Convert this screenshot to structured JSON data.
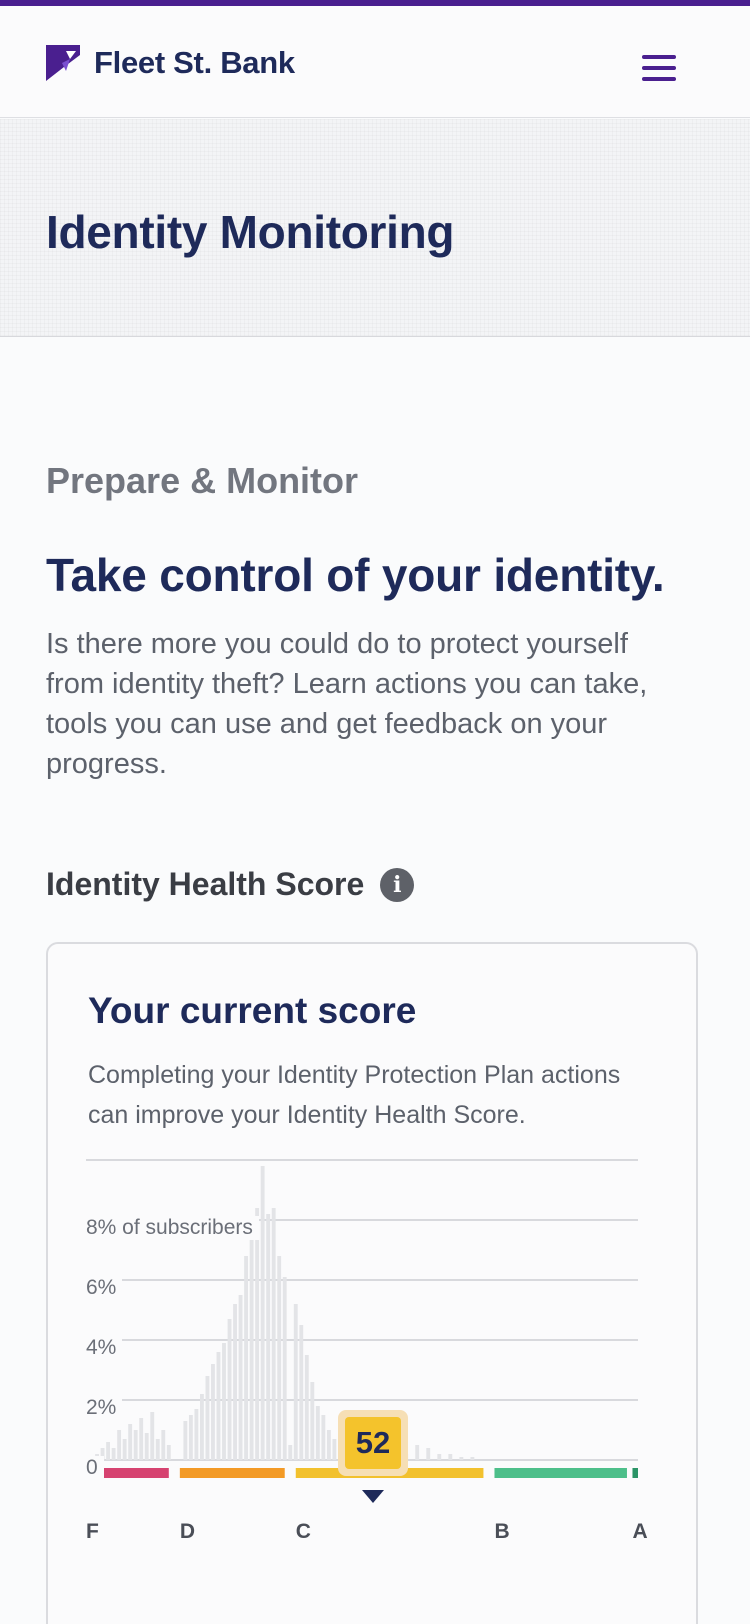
{
  "header": {
    "brand": "Fleet St. Bank",
    "logo_icon": "flag-logo-icon",
    "menu_icon": "hamburger-menu-icon",
    "accent_color": "#4a1f8f"
  },
  "hero": {
    "title": "Identity Monitoring"
  },
  "section": {
    "eyebrow": "Prepare & Monitor",
    "headline": "Take control of your identity.",
    "intro": "Is there more you could do to protect yourself from identity theft? Learn actions you can take, tools you can use and get feedback on your progress."
  },
  "score_section": {
    "title": "Identity Health Score",
    "info_icon": "info-icon",
    "card": {
      "title": "Your current score",
      "description": "Completing your Identity Protection Plan actions can improve your Identity Health Score.",
      "current_score": "52"
    }
  },
  "chart_data": {
    "type": "bar",
    "y_tick_labels": [
      "8% of subscribers",
      "6%",
      "4%",
      "2%",
      "0"
    ],
    "y_ticks": [
      8,
      6,
      4,
      2,
      0
    ],
    "ylim": [
      0,
      10
    ],
    "xlim": [
      0,
      100
    ],
    "grid": true,
    "grades": [
      {
        "label": "F",
        "range": [
          0,
          15
        ],
        "color": "#d64270"
      },
      {
        "label": "D",
        "range": [
          17,
          36
        ],
        "color": "#f39a26"
      },
      {
        "label": "C",
        "range": [
          38,
          72
        ],
        "color": "#f2c12e"
      },
      {
        "label": "B",
        "range": [
          74,
          98
        ],
        "color": "#4dbf8a"
      },
      {
        "label": "A",
        "range": [
          99,
          100
        ],
        "color": "#2b9467"
      }
    ],
    "grade_labels": [
      "F",
      "D",
      "C",
      "B",
      "A"
    ],
    "x": [
      2,
      3,
      4,
      5,
      6,
      7,
      8,
      9,
      10,
      11,
      12,
      13,
      14,
      15,
      18,
      19,
      20,
      21,
      22,
      23,
      24,
      25,
      26,
      27,
      28,
      29,
      30,
      31,
      32,
      33,
      34,
      35,
      36,
      37,
      38,
      39,
      40,
      41,
      42,
      43,
      44,
      45,
      46,
      47,
      48,
      49,
      50,
      52,
      54,
      56,
      58,
      60,
      62,
      64,
      66,
      68,
      70
    ],
    "values": [
      0.2,
      0.4,
      0.6,
      0.4,
      1.0,
      0.7,
      1.2,
      1.0,
      1.4,
      0.9,
      1.6,
      0.7,
      1.0,
      0.5,
      1.3,
      1.5,
      1.7,
      2.2,
      2.8,
      3.2,
      3.6,
      3.9,
      4.7,
      5.2,
      5.5,
      6.8,
      7.5,
      8.4,
      9.8,
      8.2,
      8.4,
      6.8,
      6.1,
      0.5,
      5.2,
      4.5,
      3.5,
      2.6,
      1.8,
      1.5,
      1.0,
      0.7,
      0.6,
      0.5,
      0.4,
      0.3,
      0.3,
      0.2,
      0.2,
      0.1,
      0.2,
      0.5,
      0.4,
      0.2,
      0.2,
      0.1,
      0.1
    ],
    "bar_color": "#e3e4e7",
    "marker": {
      "label": "52",
      "value": 52
    }
  }
}
